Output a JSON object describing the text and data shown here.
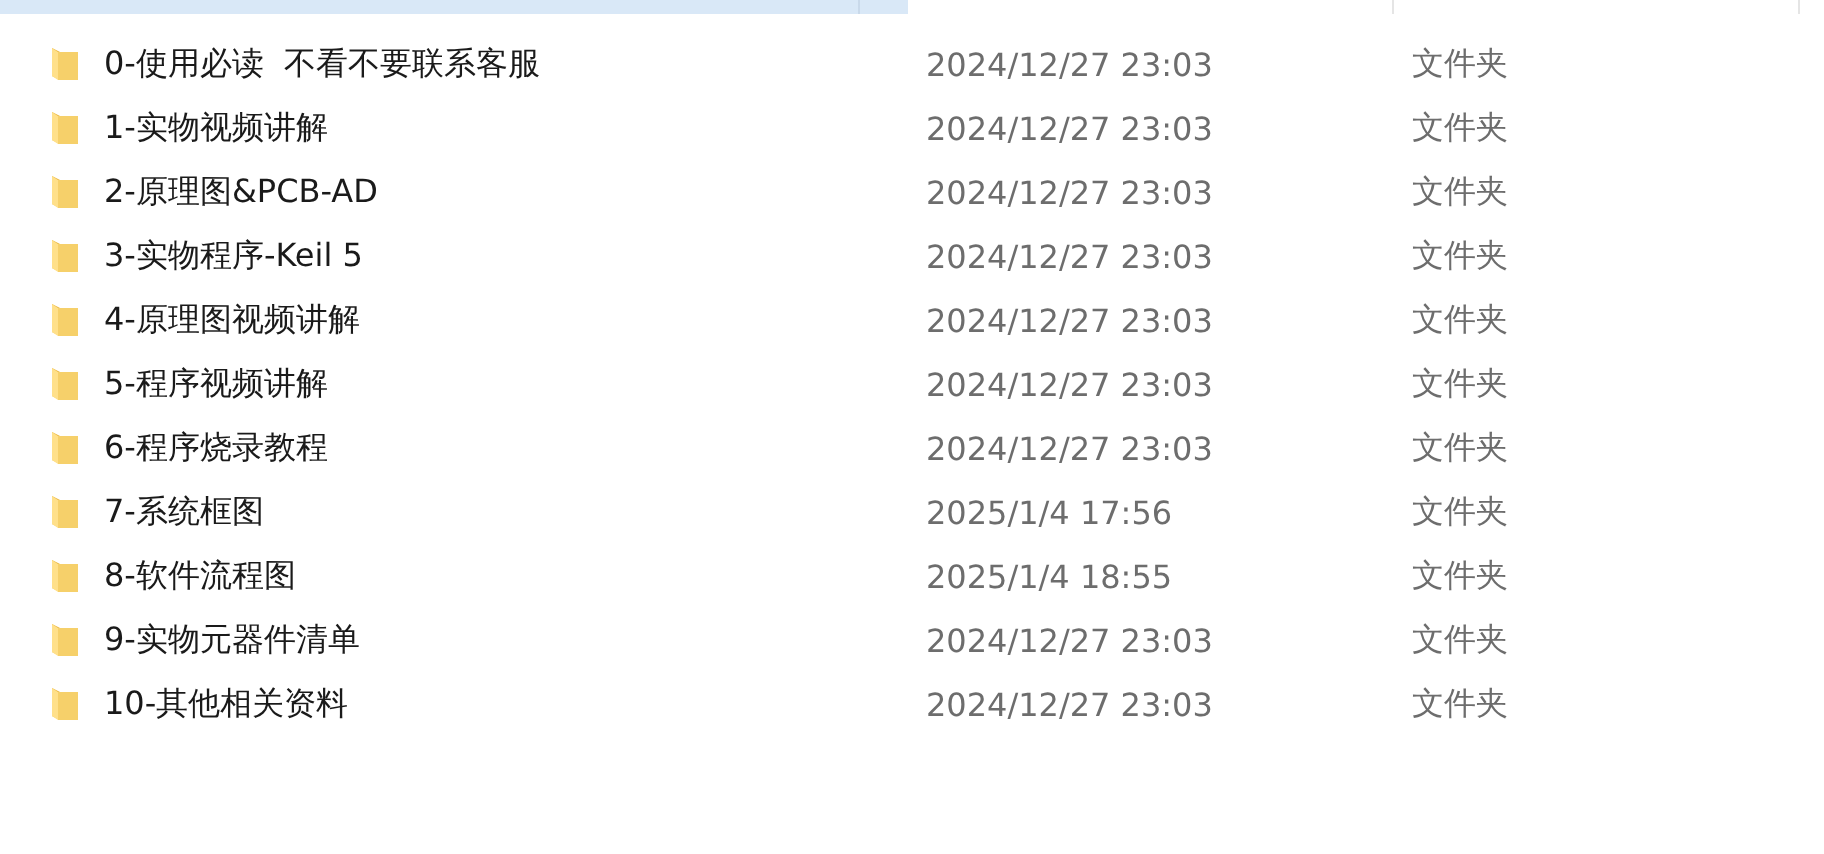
{
  "files": [
    {
      "name": "0-使用必读  不看不要联系客服",
      "modified": "2024/12/27 23:03",
      "type": "文件夹"
    },
    {
      "name": "1-实物视频讲解",
      "modified": "2024/12/27 23:03",
      "type": "文件夹"
    },
    {
      "name": "2-原理图&PCB-AD",
      "modified": "2024/12/27 23:03",
      "type": "文件夹"
    },
    {
      "name": "3-实物程序-Keil 5",
      "modified": "2024/12/27 23:03",
      "type": "文件夹"
    },
    {
      "name": "4-原理图视频讲解",
      "modified": "2024/12/27 23:03",
      "type": "文件夹"
    },
    {
      "name": "5-程序视频讲解",
      "modified": "2024/12/27 23:03",
      "type": "文件夹"
    },
    {
      "name": "6-程序烧录教程",
      "modified": "2024/12/27 23:03",
      "type": "文件夹"
    },
    {
      "name": "7-系统框图",
      "modified": "2025/1/4 17:56",
      "type": "文件夹"
    },
    {
      "name": "8-软件流程图",
      "modified": "2025/1/4 18:55",
      "type": "文件夹"
    },
    {
      "name": "9-实物元器件清单",
      "modified": "2024/12/27 23:03",
      "type": "文件夹"
    },
    {
      "name": "10-其他相关资料",
      "modified": "2024/12/27 23:03",
      "type": "文件夹"
    }
  ]
}
